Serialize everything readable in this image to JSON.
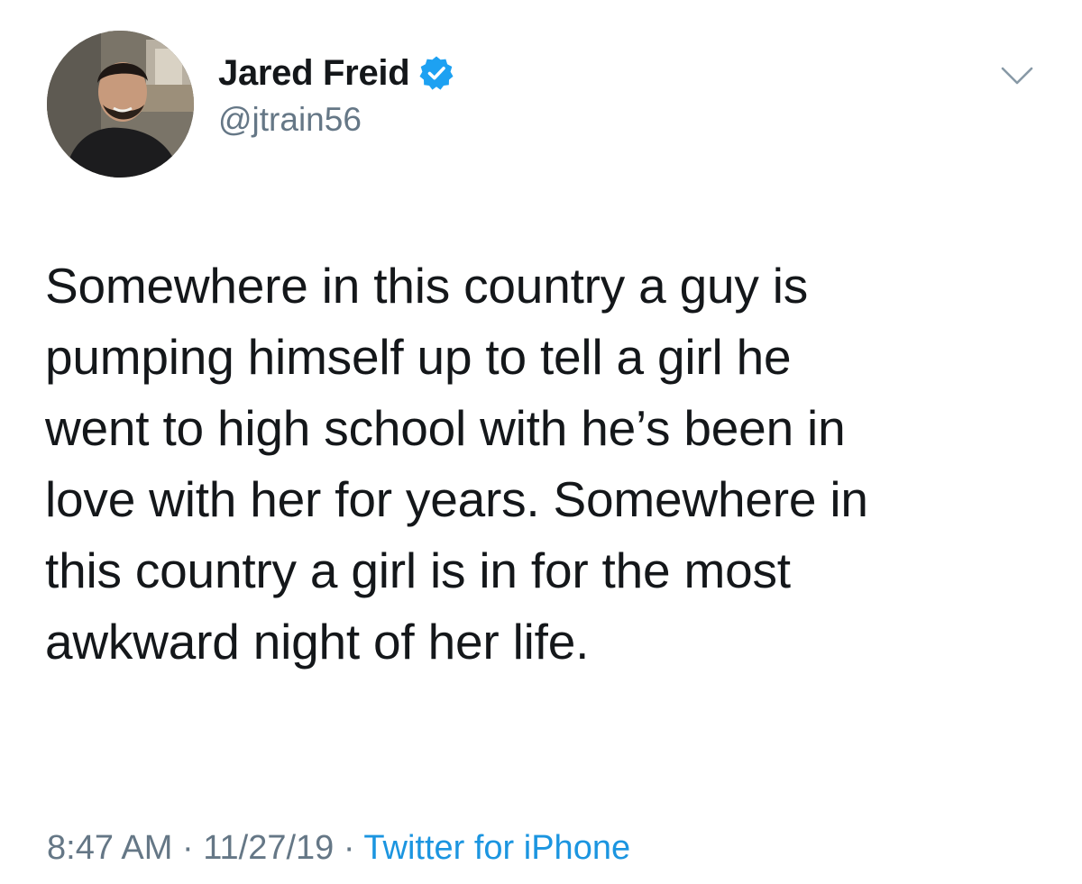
{
  "author": {
    "display_name": "Jared Freid",
    "handle": "@jtrain56",
    "verified": true
  },
  "icons": {
    "verified": "verified-badge-icon",
    "menu": "chevron-down-icon"
  },
  "tweet": {
    "text_lines": [
      "Somewhere in this country a guy is",
      "pumping himself up to tell a girl he",
      "went to high school with he’s been in",
      "love with her for years. Somewhere in",
      "this country a girl is in for the most",
      "awkward night of her life."
    ]
  },
  "meta": {
    "time": "8:47 AM",
    "separator": " · ",
    "date": "11/27/19",
    "source": "Twitter for iPhone"
  },
  "colors": {
    "verified_blue": "#1da1f2",
    "link_blue": "#1b95e0",
    "secondary_text": "#657786",
    "primary_text": "#14171a"
  }
}
